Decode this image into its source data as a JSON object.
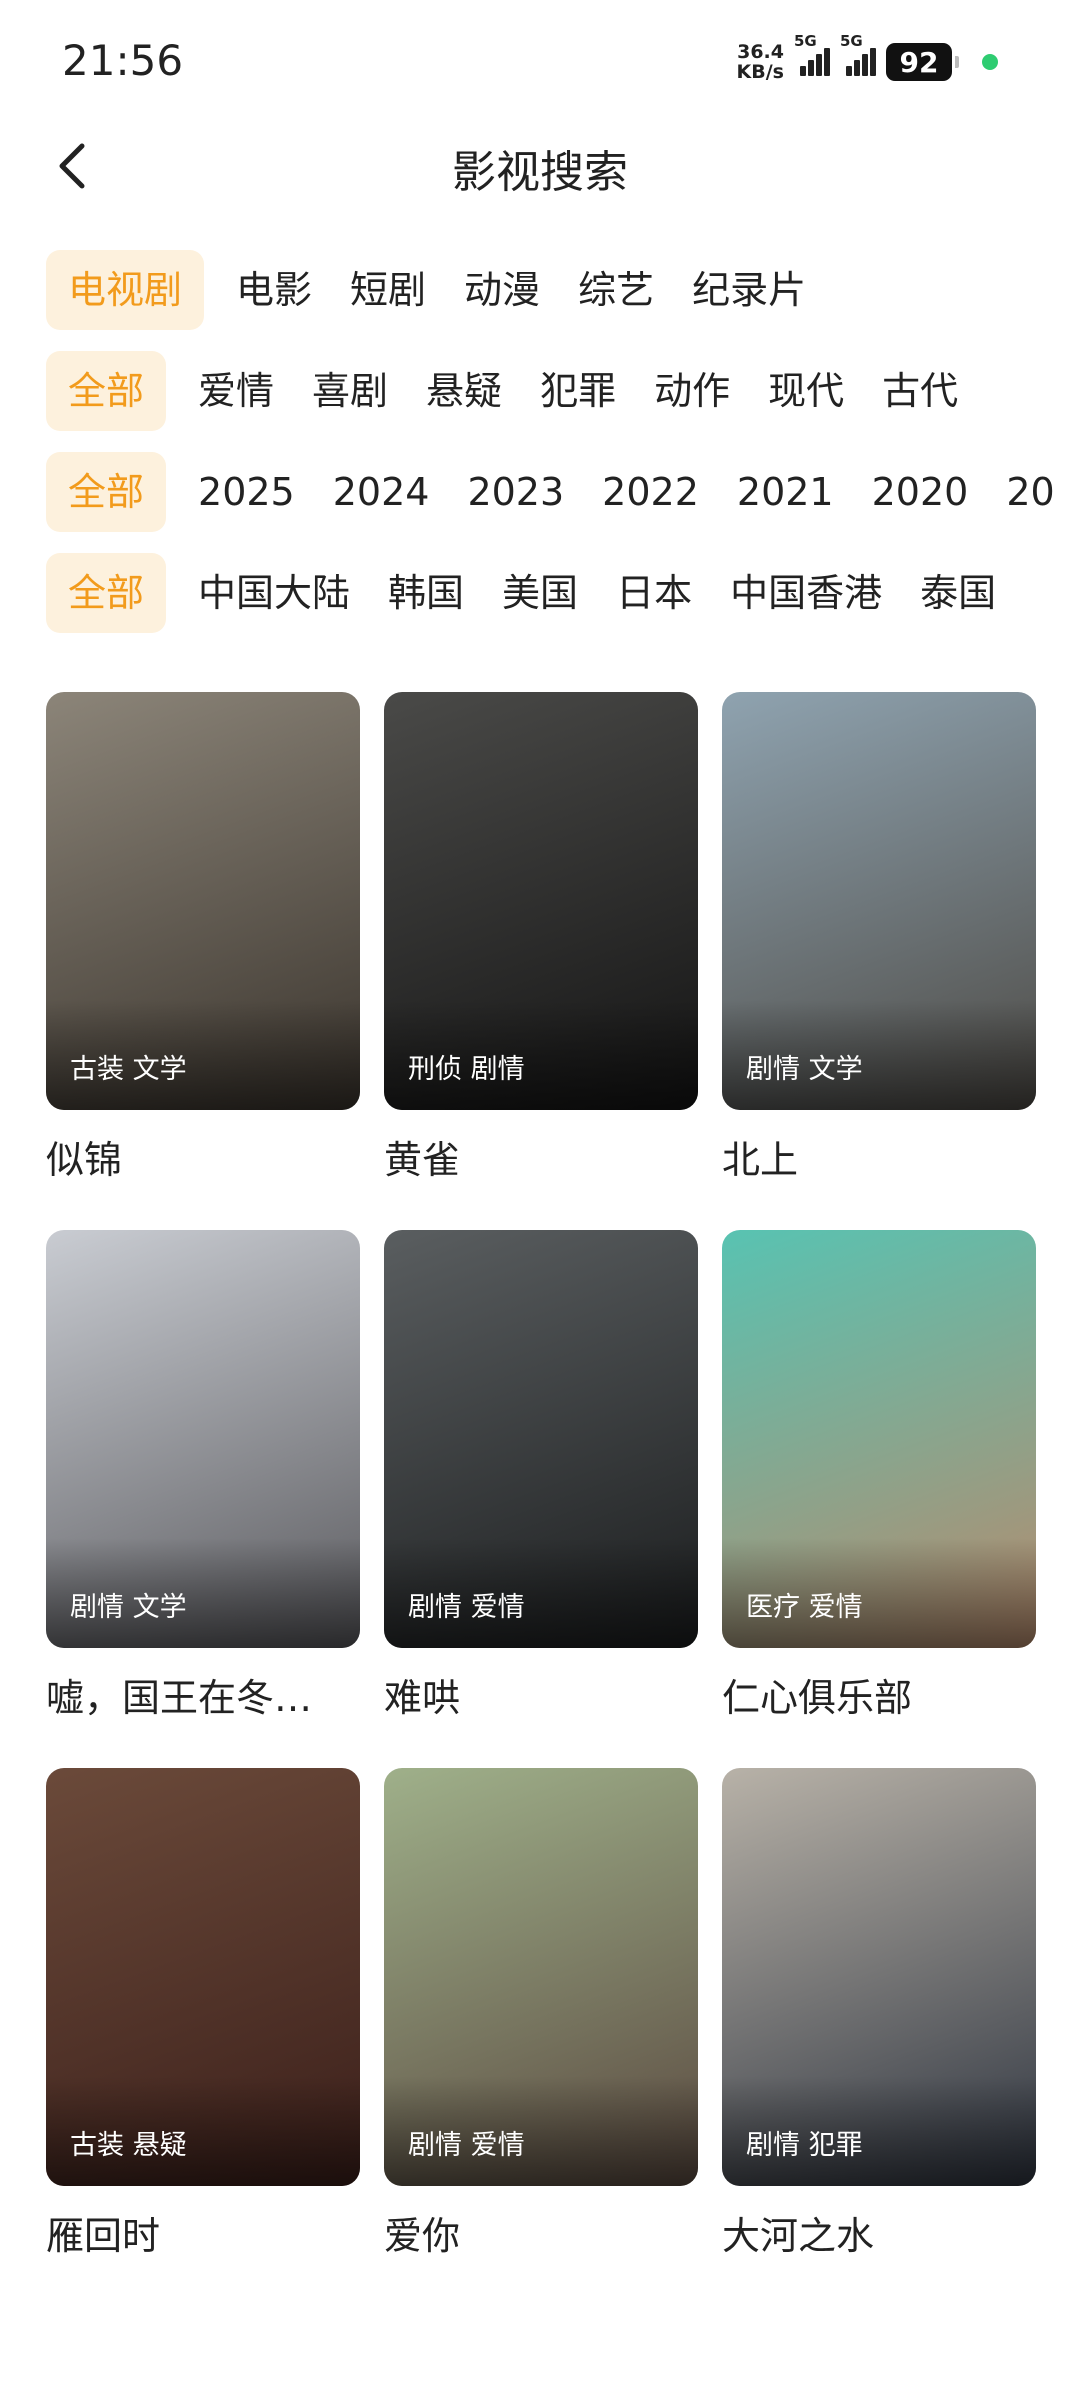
{
  "status_bar": {
    "time": "21:56",
    "net_speed_value": "36.4",
    "net_speed_unit": "KB/s",
    "sim1": "5G",
    "sim2": "5G",
    "battery": "92"
  },
  "header": {
    "title": "影视搜索"
  },
  "filters": {
    "category": [
      "电视剧",
      "电影",
      "短剧",
      "动漫",
      "综艺",
      "纪录片"
    ],
    "genre": [
      "全部",
      "爱情",
      "喜剧",
      "悬疑",
      "犯罪",
      "动作",
      "现代",
      "古代"
    ],
    "year": [
      "全部",
      "2025",
      "2024",
      "2023",
      "2022",
      "2021",
      "2020",
      "20"
    ],
    "region": [
      "全部",
      "中国大陆",
      "韩国",
      "美国",
      "日本",
      "中国香港",
      "泰国"
    ]
  },
  "items": [
    {
      "title": "似锦",
      "tags": "古装 文学",
      "colors": [
        "#8c8579",
        "#3a342d"
      ]
    },
    {
      "title": "黄雀",
      "tags": "刑侦 剧情",
      "colors": [
        "#4a4a48",
        "#141414"
      ]
    },
    {
      "title": "北上",
      "tags": "剧情 文学",
      "colors": [
        "#8fa3b0",
        "#4d4a45"
      ]
    },
    {
      "title": "嘘，国王在冬…",
      "tags": "剧情 文学",
      "colors": [
        "#c9ccd2",
        "#5a5a5e"
      ]
    },
    {
      "title": "难哄",
      "tags": "剧情 爱情",
      "colors": [
        "#5a5e60",
        "#1b1d1e"
      ]
    },
    {
      "title": "仁心俱乐部",
      "tags": "医疗 爱情",
      "colors": [
        "#58c3b2",
        "#b68a6c"
      ]
    },
    {
      "title": "雁回时",
      "tags": "古装 悬疑",
      "colors": [
        "#6b4a3a",
        "#3b1f1a"
      ]
    },
    {
      "title": "爱你",
      "tags": "剧情 爱情",
      "colors": [
        "#9fb08a",
        "#5a4a40"
      ]
    },
    {
      "title": "大河之水",
      "tags": "剧情 犯罪",
      "colors": [
        "#b8b2a8",
        "#2f3540"
      ]
    }
  ]
}
